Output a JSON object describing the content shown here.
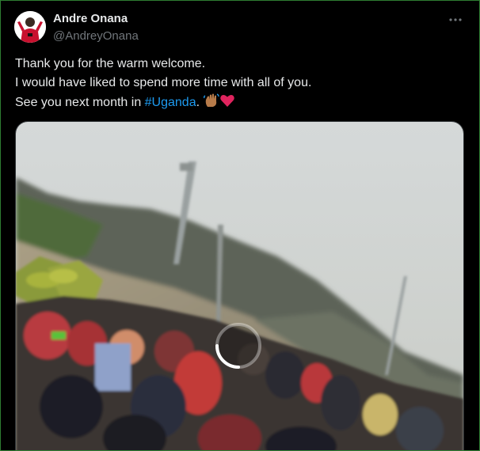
{
  "tweet": {
    "author": {
      "display_name": "Andre Onana",
      "handle": "@AndreyOnana"
    },
    "text_lines": [
      "Thank you for the warm welcome.",
      "I would have liked to spend more time with all of you."
    ],
    "line3_prefix": "See you next month in ",
    "hashtag": "#Uganda",
    "line3_suffix": ".",
    "emojis": [
      "waving-hands",
      "red-heart"
    ]
  },
  "media": {
    "kind": "video",
    "state": "loading"
  },
  "colors": {
    "background": "#000000",
    "text_primary": "#e7e9ea",
    "text_secondary": "#71767b",
    "link": "#1d9bf0",
    "frame_border": "#2e7d32"
  },
  "icons": [
    "more-options-icon",
    "loading-spinner-icon",
    "waving-hand-emoji",
    "red-heart-emoji"
  ]
}
